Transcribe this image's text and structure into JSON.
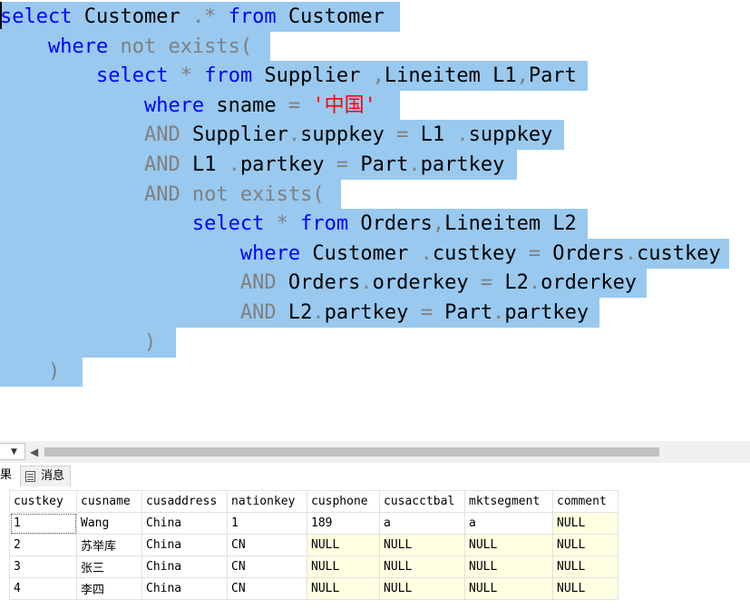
{
  "editor": {
    "lines": [
      [
        {
          "t": "select",
          "c": "kw"
        },
        {
          "t": " Customer ",
          "c": "id"
        },
        {
          "t": ".*",
          "c": "op"
        },
        {
          "t": " ",
          "c": "id"
        },
        {
          "t": "from",
          "c": "kw"
        },
        {
          "t": " Customer",
          "c": "id"
        }
      ],
      [
        {
          "t": "    ",
          "c": "id"
        },
        {
          "t": "where",
          "c": "kw"
        },
        {
          "t": " not exists(",
          "c": "op"
        }
      ],
      [
        {
          "t": "        ",
          "c": "id"
        },
        {
          "t": "select",
          "c": "kw"
        },
        {
          "t": " * ",
          "c": "op"
        },
        {
          "t": "from",
          "c": "kw"
        },
        {
          "t": " Supplier ",
          "c": "id"
        },
        {
          "t": ",",
          "c": "op"
        },
        {
          "t": "Lineitem L1",
          "c": "id"
        },
        {
          "t": ",",
          "c": "op"
        },
        {
          "t": "Part",
          "c": "id"
        }
      ],
      [
        {
          "t": "            ",
          "c": "id"
        },
        {
          "t": "where",
          "c": "kw"
        },
        {
          "t": " sname ",
          "c": "id"
        },
        {
          "t": "=",
          "c": "op"
        },
        {
          "t": " ",
          "c": "id"
        },
        {
          "t": "'中国'",
          "c": "str"
        }
      ],
      [
        {
          "t": "            ",
          "c": "id"
        },
        {
          "t": "AND",
          "c": "op"
        },
        {
          "t": " Supplier",
          "c": "id"
        },
        {
          "t": ".",
          "c": "op"
        },
        {
          "t": "suppkey ",
          "c": "id"
        },
        {
          "t": "=",
          "c": "op"
        },
        {
          "t": " L1 ",
          "c": "id"
        },
        {
          "t": ".",
          "c": "op"
        },
        {
          "t": "suppkey",
          "c": "id"
        }
      ],
      [
        {
          "t": "            ",
          "c": "id"
        },
        {
          "t": "AND",
          "c": "op"
        },
        {
          "t": " L1 ",
          "c": "id"
        },
        {
          "t": ".",
          "c": "op"
        },
        {
          "t": "partkey ",
          "c": "id"
        },
        {
          "t": "=",
          "c": "op"
        },
        {
          "t": " Part",
          "c": "id"
        },
        {
          "t": ".",
          "c": "op"
        },
        {
          "t": "partkey",
          "c": "id"
        }
      ],
      [
        {
          "t": "            ",
          "c": "id"
        },
        {
          "t": "AND not exists(",
          "c": "op"
        }
      ],
      [
        {
          "t": "                ",
          "c": "id"
        },
        {
          "t": "select",
          "c": "kw"
        },
        {
          "t": " * ",
          "c": "op"
        },
        {
          "t": "from",
          "c": "kw"
        },
        {
          "t": " Orders",
          "c": "id"
        },
        {
          "t": ",",
          "c": "op"
        },
        {
          "t": "Lineitem L2",
          "c": "id"
        }
      ],
      [
        {
          "t": "                    ",
          "c": "id"
        },
        {
          "t": "where",
          "c": "kw"
        },
        {
          "t": " Customer ",
          "c": "id"
        },
        {
          "t": ".",
          "c": "op"
        },
        {
          "t": "custkey ",
          "c": "id"
        },
        {
          "t": "=",
          "c": "op"
        },
        {
          "t": " Orders",
          "c": "id"
        },
        {
          "t": ".",
          "c": "op"
        },
        {
          "t": "custkey",
          "c": "id"
        }
      ],
      [
        {
          "t": "                    ",
          "c": "id"
        },
        {
          "t": "AND",
          "c": "op"
        },
        {
          "t": " Orders",
          "c": "id"
        },
        {
          "t": ".",
          "c": "op"
        },
        {
          "t": "orderkey ",
          "c": "id"
        },
        {
          "t": "=",
          "c": "op"
        },
        {
          "t": " L2",
          "c": "id"
        },
        {
          "t": ".",
          "c": "op"
        },
        {
          "t": "orderkey",
          "c": "id"
        }
      ],
      [
        {
          "t": "                    ",
          "c": "id"
        },
        {
          "t": "AND",
          "c": "op"
        },
        {
          "t": " L2",
          "c": "id"
        },
        {
          "t": ".",
          "c": "op"
        },
        {
          "t": "partkey ",
          "c": "id"
        },
        {
          "t": "=",
          "c": "op"
        },
        {
          "t": " Part",
          "c": "id"
        },
        {
          "t": ".",
          "c": "op"
        },
        {
          "t": "partkey",
          "c": "id"
        }
      ],
      [
        {
          "t": "            ",
          "c": "id"
        },
        {
          "t": ")",
          "c": "op"
        }
      ],
      [
        {
          "t": "    ",
          "c": "id"
        },
        {
          "t": ")",
          "c": "op"
        }
      ]
    ],
    "colors": {
      "keyword": "#0000ff",
      "operator": "#808080",
      "string": "#ff0000",
      "identifier": "#000000",
      "selection": "#99c9ef"
    }
  },
  "toolbar": {
    "zoom_arrow": "▼",
    "scroll_left_arrow": "◀"
  },
  "tabs": {
    "results": "果",
    "messages": "消息"
  },
  "grid": {
    "columns": [
      "custkey",
      "cusname",
      "cusaddress",
      "nationkey",
      "cusphone",
      "cusacctbal",
      "mktsegment",
      "comment"
    ],
    "rows": [
      [
        "1",
        "Wang",
        "China",
        "1",
        "189",
        "a",
        "a",
        "NULL"
      ],
      [
        "2",
        "苏举库",
        "China",
        "CN",
        "NULL",
        "NULL",
        "NULL",
        "NULL"
      ],
      [
        "3",
        "张三",
        "China",
        "CN",
        "NULL",
        "NULL",
        "NULL",
        "NULL"
      ],
      [
        "4",
        "李四",
        "China",
        "CN",
        "NULL",
        "NULL",
        "NULL",
        "NULL"
      ]
    ],
    "null_color": "#ffffe1"
  }
}
